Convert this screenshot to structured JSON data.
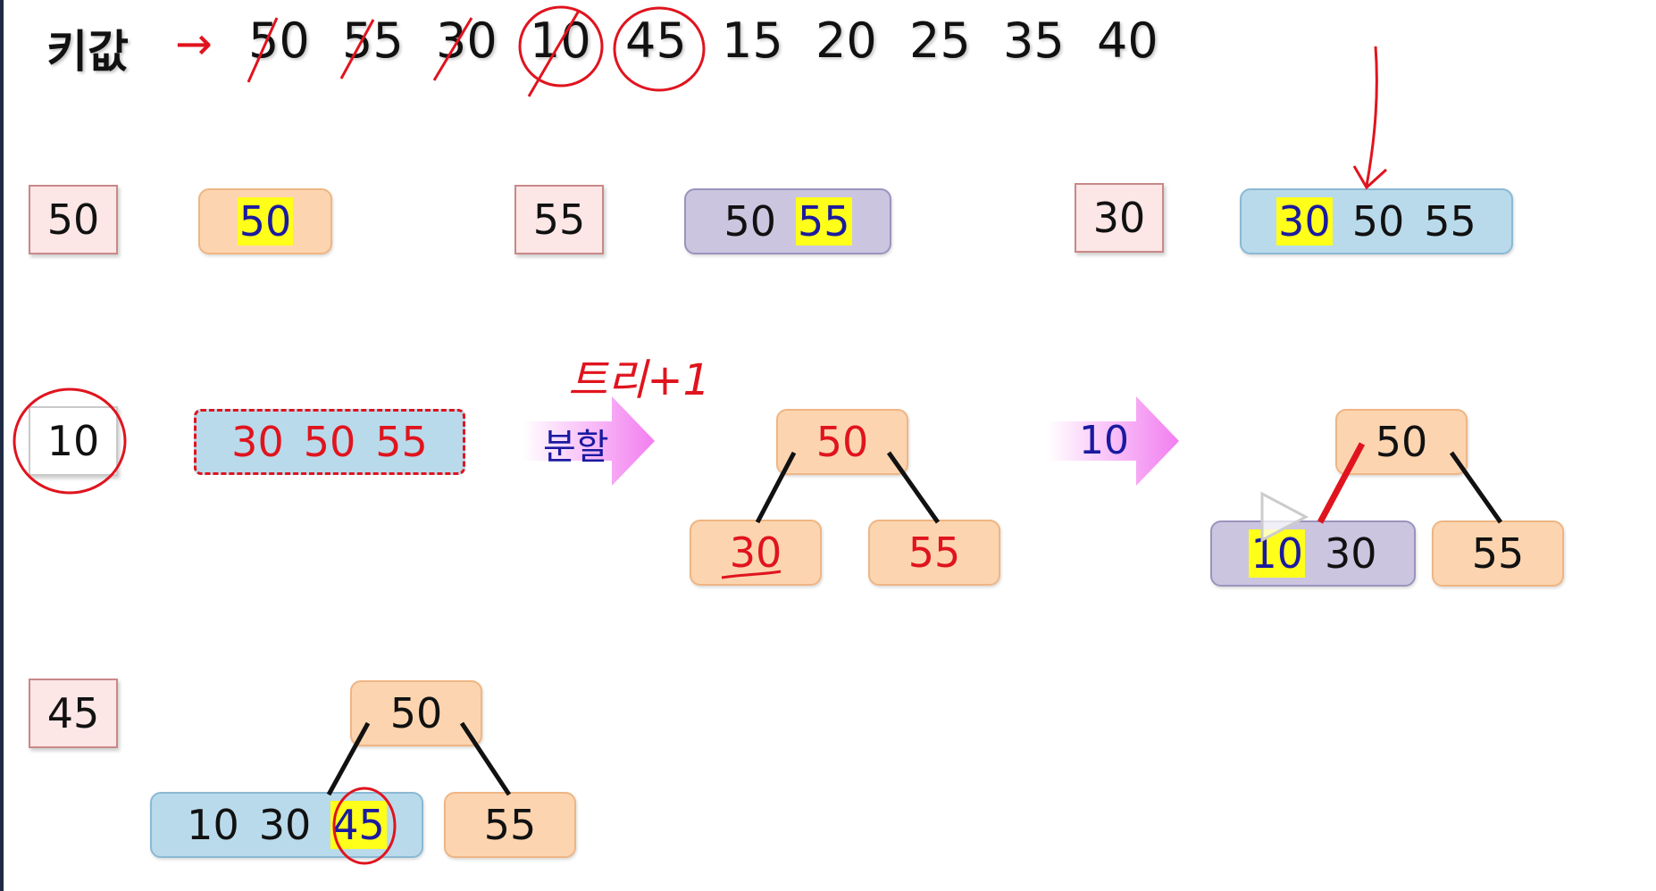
{
  "header": {
    "label": "키값",
    "arrow": "→",
    "keys": [
      "50",
      "55",
      "30",
      "10",
      "45",
      "15",
      "20",
      "25",
      "35",
      "40"
    ]
  },
  "rows": {
    "r1": {
      "input1": "50",
      "node1": "50",
      "input2": "55",
      "node2_a": "50",
      "node2_b": "55",
      "input3": "30",
      "node3_a": "30",
      "node3_b": "50",
      "node3_c": "55"
    },
    "r2": {
      "input": "10",
      "overflow_a": "30",
      "overflow_b": "50",
      "overflow_c": "55",
      "split_label": "분할",
      "handwritten": "트리+1",
      "root": "50",
      "left": "30",
      "right": "55",
      "insert_label": "10",
      "root2": "50",
      "left2_a": "10",
      "left2_b": "30",
      "right2": "55"
    },
    "r3": {
      "input": "45",
      "root": "50",
      "left_a": "10",
      "left_b": "30",
      "left_c": "45",
      "right": "55"
    }
  },
  "colors": {
    "ink_red": "#e0141e",
    "node_orange": "#fcd5b0",
    "node_purple": "#cbc5e0",
    "node_blue": "#b9daea",
    "input_box": "#fde6e6",
    "highlight": "#ffff1a",
    "highlight_text": "#1a1aa0"
  },
  "icons": [
    "play-icon",
    "right-arrow-icon"
  ]
}
